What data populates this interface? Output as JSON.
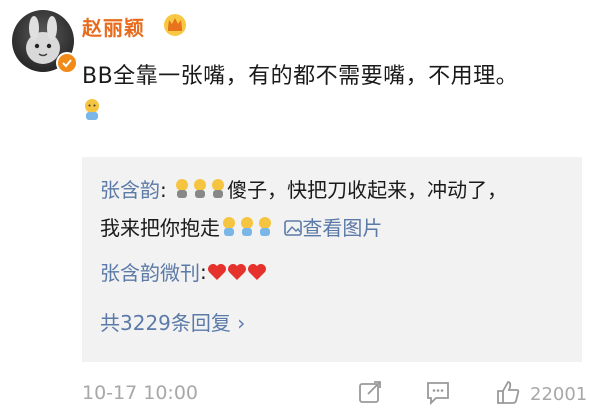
{
  "post": {
    "author": "赵丽颖",
    "text": "BB全靠一张嘴，有的都不需要嘴，不用理。",
    "time": "10-17 10:00",
    "likes": "22001"
  },
  "replies": {
    "first": {
      "author": "张含韵",
      "separator": ":",
      "text_a": "傻子，快把刀收起来，冲动了，",
      "text_b": "我来把你抱走",
      "view_image": "查看图片"
    },
    "second": {
      "author": "张含韵微刊",
      "separator": ":"
    },
    "more_label": "共3229条回复 ›"
  },
  "colors": {
    "author": "#e86b1d",
    "link": "#5b7aa8",
    "muted": "#a8a8a8",
    "quote_bg": "#f2f2f2",
    "heart": "#e5322d"
  },
  "icons": [
    "crown-icon",
    "verified-badge-icon",
    "emoji-icon",
    "image-icon",
    "heart-icon",
    "repost-icon",
    "comment-icon",
    "like-icon"
  ]
}
